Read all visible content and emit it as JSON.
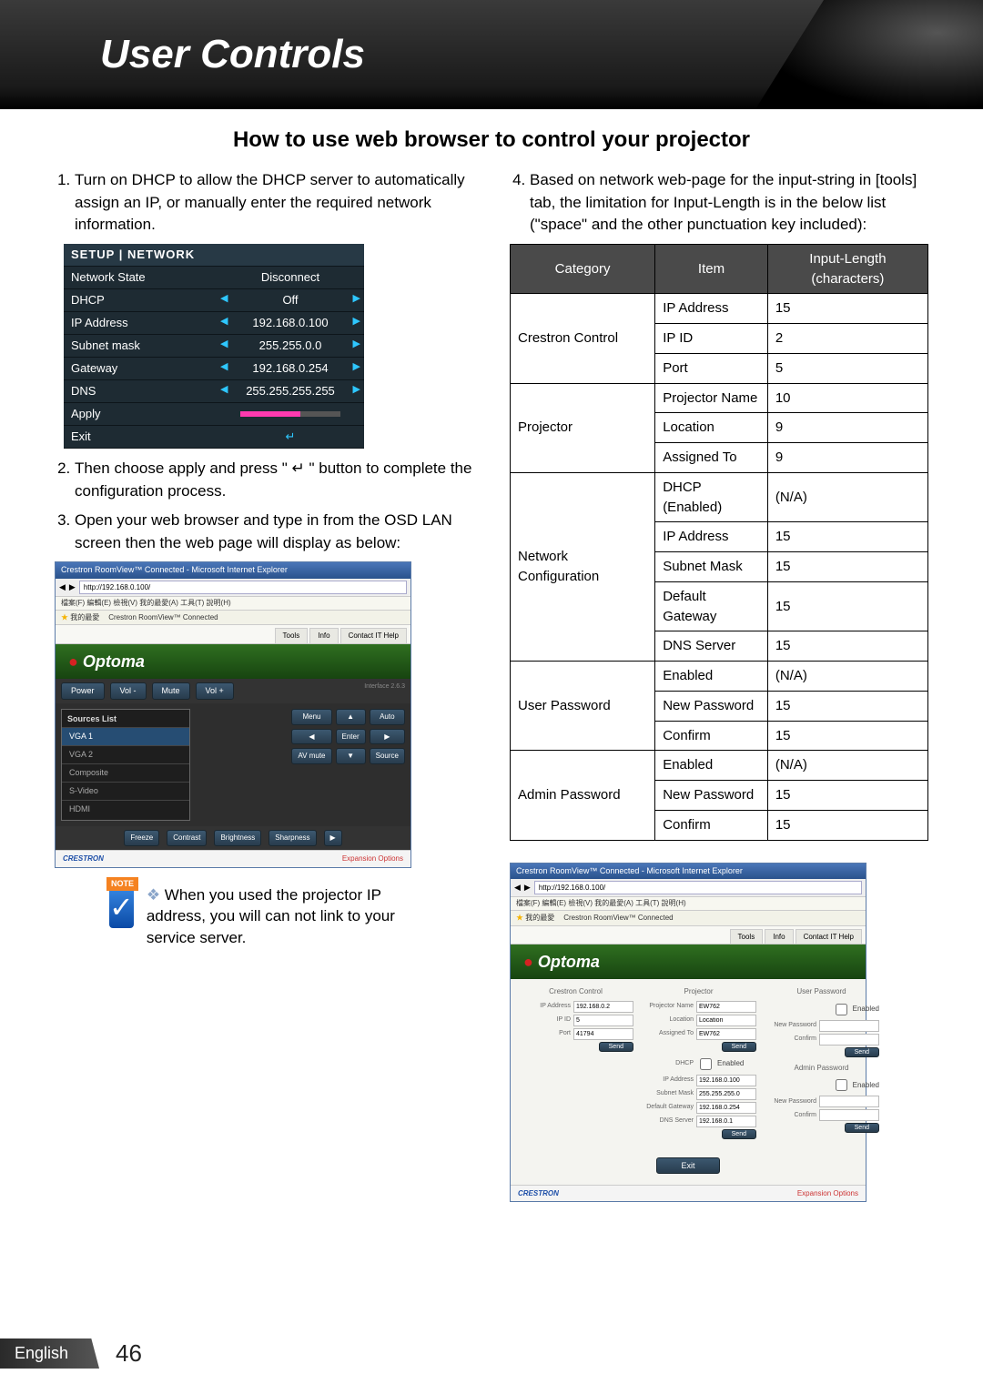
{
  "banner_title": "User Controls",
  "section_title": "How to use web browser to control your projector",
  "steps": {
    "1": "Turn on DHCP to allow the DHCP server to automatically assign an IP, or manually enter the required network information.",
    "2": "Then choose apply and press \" ↵ \" button to complete the configuration process.",
    "3": "Open your web browser and type in from the OSD LAN screen then the web page will display as below:",
    "4": "Based on network web-page for the input-string in [tools] tab, the limitation for Input-Length is in the below list (\"space\" and the other punctuation key included):"
  },
  "osd": {
    "header": "SETUP  |  NETWORK",
    "rows": [
      {
        "label": "Network State",
        "value": "Disconnect"
      },
      {
        "label": "DHCP",
        "value": "Off"
      },
      {
        "label": "IP Address",
        "value": "192.168.0.100"
      },
      {
        "label": "Subnet mask",
        "value": "255.255.0.0"
      },
      {
        "label": "Gateway",
        "value": "192.168.0.254"
      },
      {
        "label": "DNS",
        "value": "255.255.255.255"
      },
      {
        "label": "Apply",
        "value": ""
      },
      {
        "label": "Exit",
        "value": ""
      }
    ]
  },
  "limit_table": {
    "headers": [
      "Category",
      "Item",
      "Input-Length (characters)"
    ],
    "rows": [
      {
        "cat": "Crestron Control",
        "catspan": 3,
        "item": "IP Address",
        "len": "15"
      },
      {
        "item": "IP ID",
        "len": "2"
      },
      {
        "item": "Port",
        "len": "5"
      },
      {
        "cat": "Projector",
        "catspan": 3,
        "item": "Projector Name",
        "len": "10"
      },
      {
        "item": "Location",
        "len": "9"
      },
      {
        "item": "Assigned To",
        "len": "9"
      },
      {
        "cat": "Network Configuration",
        "catspan": 5,
        "item": "DHCP (Enabled)",
        "len": "(N/A)"
      },
      {
        "item": "IP Address",
        "len": "15"
      },
      {
        "item": "Subnet Mask",
        "len": "15"
      },
      {
        "item": "Default Gateway",
        "len": "15"
      },
      {
        "item": "DNS Server",
        "len": "15"
      },
      {
        "cat": "User Password",
        "catspan": 3,
        "item": "Enabled",
        "len": "(N/A)"
      },
      {
        "item": "New Password",
        "len": "15"
      },
      {
        "item": "Confirm",
        "len": "15"
      },
      {
        "cat": "Admin Password",
        "catspan": 3,
        "item": "Enabled",
        "len": "(N/A)"
      },
      {
        "item": "New Password",
        "len": "15"
      },
      {
        "item": "Confirm",
        "len": "15"
      }
    ]
  },
  "screenshot_main": {
    "titlebar": "Crestron RoomView™ Connected - Microsoft Internet Explorer",
    "url": "http://192.168.0.100/",
    "menubar": "檔案(F)  編輯(E)  檢視(V)  我的最愛(A)  工具(T)  說明(H)",
    "fav_label": "我的最愛",
    "fav_item": "Crestron RoomView™ Connected",
    "brand": "Optoma",
    "version": "Interface 2.6.3",
    "tabs": [
      "Tools",
      "Info",
      "Contact IT Help"
    ],
    "top_buttons": [
      "Power",
      "Vol -",
      "Mute",
      "Vol +"
    ],
    "sources_header": "Sources List",
    "sources": [
      "VGA 1",
      "VGA 2",
      "Composite",
      "S-Video",
      "HDMI"
    ],
    "side_buttons": {
      "menu": "Menu",
      "auto": "Auto",
      "enter": "Enter",
      "avmute": "AV mute",
      "source": "Source"
    },
    "bottom_buttons": [
      "Freeze",
      "Contrast",
      "Brightness",
      "Sharpness"
    ],
    "footer_left": "CRESTRON",
    "footer_right": "Expansion Options"
  },
  "screenshot_tools": {
    "titlebar": "Crestron RoomView™ Connected - Microsoft Internet Explorer",
    "url": "http://192.168.0.100/",
    "menubar": "檔案(F)  編輯(E)  檢視(V)  我的最愛(A)  工具(T)  說明(H)",
    "fav_label": "我的最愛",
    "fav_item": "Crestron RoomView™ Connected",
    "brand": "Optoma",
    "tabs": [
      "Tools",
      "Info",
      "Contact IT Help"
    ],
    "crestron": {
      "heading": "Crestron Control",
      "ip_label": "IP Address",
      "ip": "192.168.0.2",
      "ipid_label": "IP ID",
      "ipid": "5",
      "port_label": "Port",
      "port": "41794",
      "send": "Send"
    },
    "projector": {
      "heading": "Projector",
      "name_label": "Projector Name",
      "name": "EW762",
      "loc_label": "Location",
      "loc": "Location",
      "ass_label": "Assigned To",
      "ass": "EW762",
      "send": "Send",
      "dhcp_label": "DHCP",
      "dhcp": "Enabled",
      "pip_label": "IP Address",
      "pip": "192.168.0.100",
      "mask_label": "Subnet Mask",
      "mask": "255.255.255.0",
      "gw_label": "Default Gateway",
      "gw": "192.168.0.254",
      "dns_label": "DNS Server",
      "dns": "192.168.0.1",
      "send2": "Send"
    },
    "user_pw": {
      "heading": "User Password",
      "enabled_label": "Enabled",
      "new_label": "New Password",
      "confirm_label": "Confirm",
      "send": "Send"
    },
    "admin_pw": {
      "heading": "Admin Password",
      "enabled_label": "Enabled",
      "new_label": "New Password",
      "confirm_label": "Confirm",
      "send": "Send"
    },
    "exit": "Exit",
    "footer_left": "CRESTRON",
    "footer_right": "Expansion Options"
  },
  "note": {
    "badge": "NOTE",
    "text": "When you used the projector IP address, you will can not link to your service server."
  },
  "footer": {
    "language": "English",
    "page": "46"
  }
}
